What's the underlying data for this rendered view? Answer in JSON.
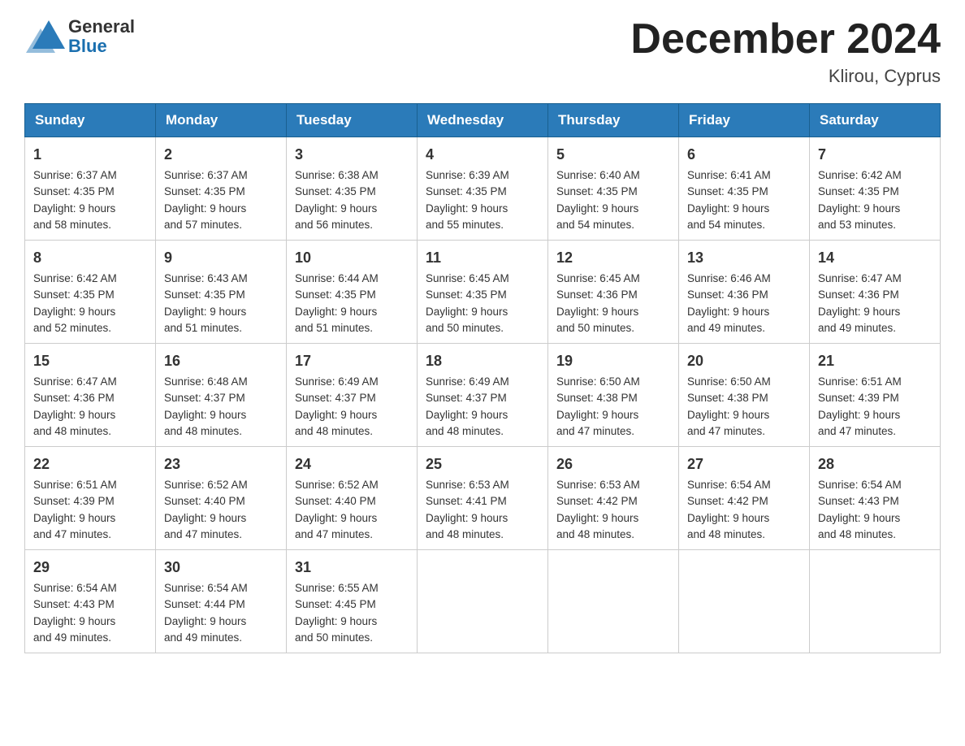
{
  "logo": {
    "general": "General",
    "blue": "Blue"
  },
  "header": {
    "month": "December 2024",
    "location": "Klirou, Cyprus"
  },
  "weekdays": [
    "Sunday",
    "Monday",
    "Tuesday",
    "Wednesday",
    "Thursday",
    "Friday",
    "Saturday"
  ],
  "weeks": [
    [
      {
        "day": "1",
        "sunrise": "6:37 AM",
        "sunset": "4:35 PM",
        "daylight_hours": "9",
        "daylight_minutes": "58"
      },
      {
        "day": "2",
        "sunrise": "6:37 AM",
        "sunset": "4:35 PM",
        "daylight_hours": "9",
        "daylight_minutes": "57"
      },
      {
        "day": "3",
        "sunrise": "6:38 AM",
        "sunset": "4:35 PM",
        "daylight_hours": "9",
        "daylight_minutes": "56"
      },
      {
        "day": "4",
        "sunrise": "6:39 AM",
        "sunset": "4:35 PM",
        "daylight_hours": "9",
        "daylight_minutes": "55"
      },
      {
        "day": "5",
        "sunrise": "6:40 AM",
        "sunset": "4:35 PM",
        "daylight_hours": "9",
        "daylight_minutes": "54"
      },
      {
        "day": "6",
        "sunrise": "6:41 AM",
        "sunset": "4:35 PM",
        "daylight_hours": "9",
        "daylight_minutes": "54"
      },
      {
        "day": "7",
        "sunrise": "6:42 AM",
        "sunset": "4:35 PM",
        "daylight_hours": "9",
        "daylight_minutes": "53"
      }
    ],
    [
      {
        "day": "8",
        "sunrise": "6:42 AM",
        "sunset": "4:35 PM",
        "daylight_hours": "9",
        "daylight_minutes": "52"
      },
      {
        "day": "9",
        "sunrise": "6:43 AM",
        "sunset": "4:35 PM",
        "daylight_hours": "9",
        "daylight_minutes": "51"
      },
      {
        "day": "10",
        "sunrise": "6:44 AM",
        "sunset": "4:35 PM",
        "daylight_hours": "9",
        "daylight_minutes": "51"
      },
      {
        "day": "11",
        "sunrise": "6:45 AM",
        "sunset": "4:35 PM",
        "daylight_hours": "9",
        "daylight_minutes": "50"
      },
      {
        "day": "12",
        "sunrise": "6:45 AM",
        "sunset": "4:36 PM",
        "daylight_hours": "9",
        "daylight_minutes": "50"
      },
      {
        "day": "13",
        "sunrise": "6:46 AM",
        "sunset": "4:36 PM",
        "daylight_hours": "9",
        "daylight_minutes": "49"
      },
      {
        "day": "14",
        "sunrise": "6:47 AM",
        "sunset": "4:36 PM",
        "daylight_hours": "9",
        "daylight_minutes": "49"
      }
    ],
    [
      {
        "day": "15",
        "sunrise": "6:47 AM",
        "sunset": "4:36 PM",
        "daylight_hours": "9",
        "daylight_minutes": "48"
      },
      {
        "day": "16",
        "sunrise": "6:48 AM",
        "sunset": "4:37 PM",
        "daylight_hours": "9",
        "daylight_minutes": "48"
      },
      {
        "day": "17",
        "sunrise": "6:49 AM",
        "sunset": "4:37 PM",
        "daylight_hours": "9",
        "daylight_minutes": "48"
      },
      {
        "day": "18",
        "sunrise": "6:49 AM",
        "sunset": "4:37 PM",
        "daylight_hours": "9",
        "daylight_minutes": "48"
      },
      {
        "day": "19",
        "sunrise": "6:50 AM",
        "sunset": "4:38 PM",
        "daylight_hours": "9",
        "daylight_minutes": "47"
      },
      {
        "day": "20",
        "sunrise": "6:50 AM",
        "sunset": "4:38 PM",
        "daylight_hours": "9",
        "daylight_minutes": "47"
      },
      {
        "day": "21",
        "sunrise": "6:51 AM",
        "sunset": "4:39 PM",
        "daylight_hours": "9",
        "daylight_minutes": "47"
      }
    ],
    [
      {
        "day": "22",
        "sunrise": "6:51 AM",
        "sunset": "4:39 PM",
        "daylight_hours": "9",
        "daylight_minutes": "47"
      },
      {
        "day": "23",
        "sunrise": "6:52 AM",
        "sunset": "4:40 PM",
        "daylight_hours": "9",
        "daylight_minutes": "47"
      },
      {
        "day": "24",
        "sunrise": "6:52 AM",
        "sunset": "4:40 PM",
        "daylight_hours": "9",
        "daylight_minutes": "47"
      },
      {
        "day": "25",
        "sunrise": "6:53 AM",
        "sunset": "4:41 PM",
        "daylight_hours": "9",
        "daylight_minutes": "48"
      },
      {
        "day": "26",
        "sunrise": "6:53 AM",
        "sunset": "4:42 PM",
        "daylight_hours": "9",
        "daylight_minutes": "48"
      },
      {
        "day": "27",
        "sunrise": "6:54 AM",
        "sunset": "4:42 PM",
        "daylight_hours": "9",
        "daylight_minutes": "48"
      },
      {
        "day": "28",
        "sunrise": "6:54 AM",
        "sunset": "4:43 PM",
        "daylight_hours": "9",
        "daylight_minutes": "48"
      }
    ],
    [
      {
        "day": "29",
        "sunrise": "6:54 AM",
        "sunset": "4:43 PM",
        "daylight_hours": "9",
        "daylight_minutes": "49"
      },
      {
        "day": "30",
        "sunrise": "6:54 AM",
        "sunset": "4:44 PM",
        "daylight_hours": "9",
        "daylight_minutes": "49"
      },
      {
        "day": "31",
        "sunrise": "6:55 AM",
        "sunset": "4:45 PM",
        "daylight_hours": "9",
        "daylight_minutes": "50"
      },
      null,
      null,
      null,
      null
    ]
  ],
  "labels": {
    "sunrise": "Sunrise:",
    "sunset": "Sunset:",
    "daylight": "Daylight:",
    "hours": "hours",
    "and": "and",
    "minutes": "minutes."
  }
}
